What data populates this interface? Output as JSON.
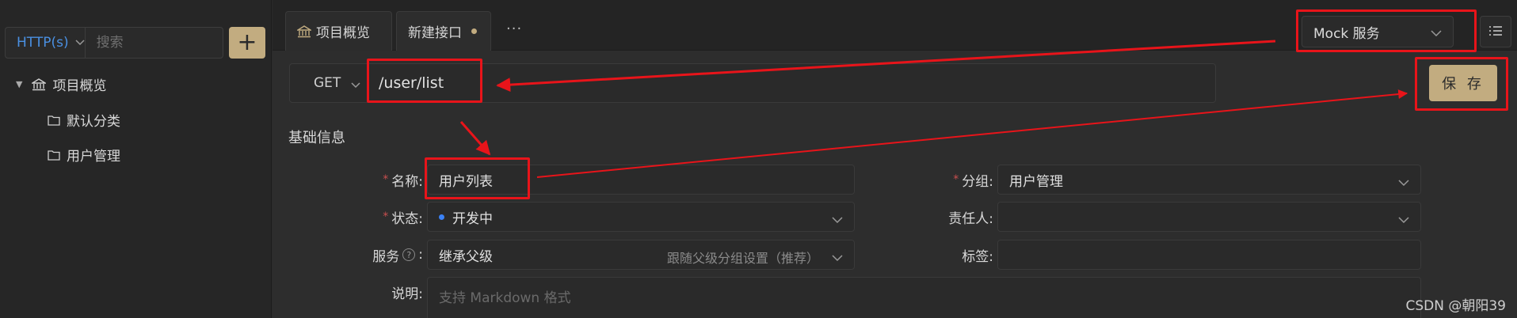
{
  "sidebar": {
    "protocol": "HTTP(s)",
    "search_placeholder": "搜索",
    "add_label": "+",
    "tree": [
      {
        "label": "项目概览"
      },
      {
        "label": "默认分类"
      },
      {
        "label": "用户管理"
      }
    ]
  },
  "tabs": {
    "items": [
      {
        "label": "项目概览"
      },
      {
        "label": "新建接口"
      }
    ],
    "more": "···"
  },
  "mock": {
    "label": "Mock 服务"
  },
  "request": {
    "method": "GET",
    "url": "/user/list",
    "save_label": "保 存"
  },
  "form": {
    "section_title": "基础信息",
    "name_label": "名称:",
    "name_value": "用户列表",
    "group_label": "分组:",
    "group_value": "用户管理",
    "status_label": "状态:",
    "status_value": "开发中",
    "owner_label": "责任人:",
    "service_label": "服务",
    "service_colon": ":",
    "service_help": "?",
    "service_value": "继承父级",
    "service_hint": "跟随父级分组设置（推荐）",
    "tags_label": "标签:",
    "desc_label": "说明:",
    "desc_placeholder": "支持 Markdown 格式"
  },
  "colors": {
    "accent": "#c2ac80",
    "annotation": "#e8141a",
    "protocol_text": "#4a90e2",
    "status_dot": "#3b82f6"
  },
  "watermark": "CSDN @朝阳39"
}
